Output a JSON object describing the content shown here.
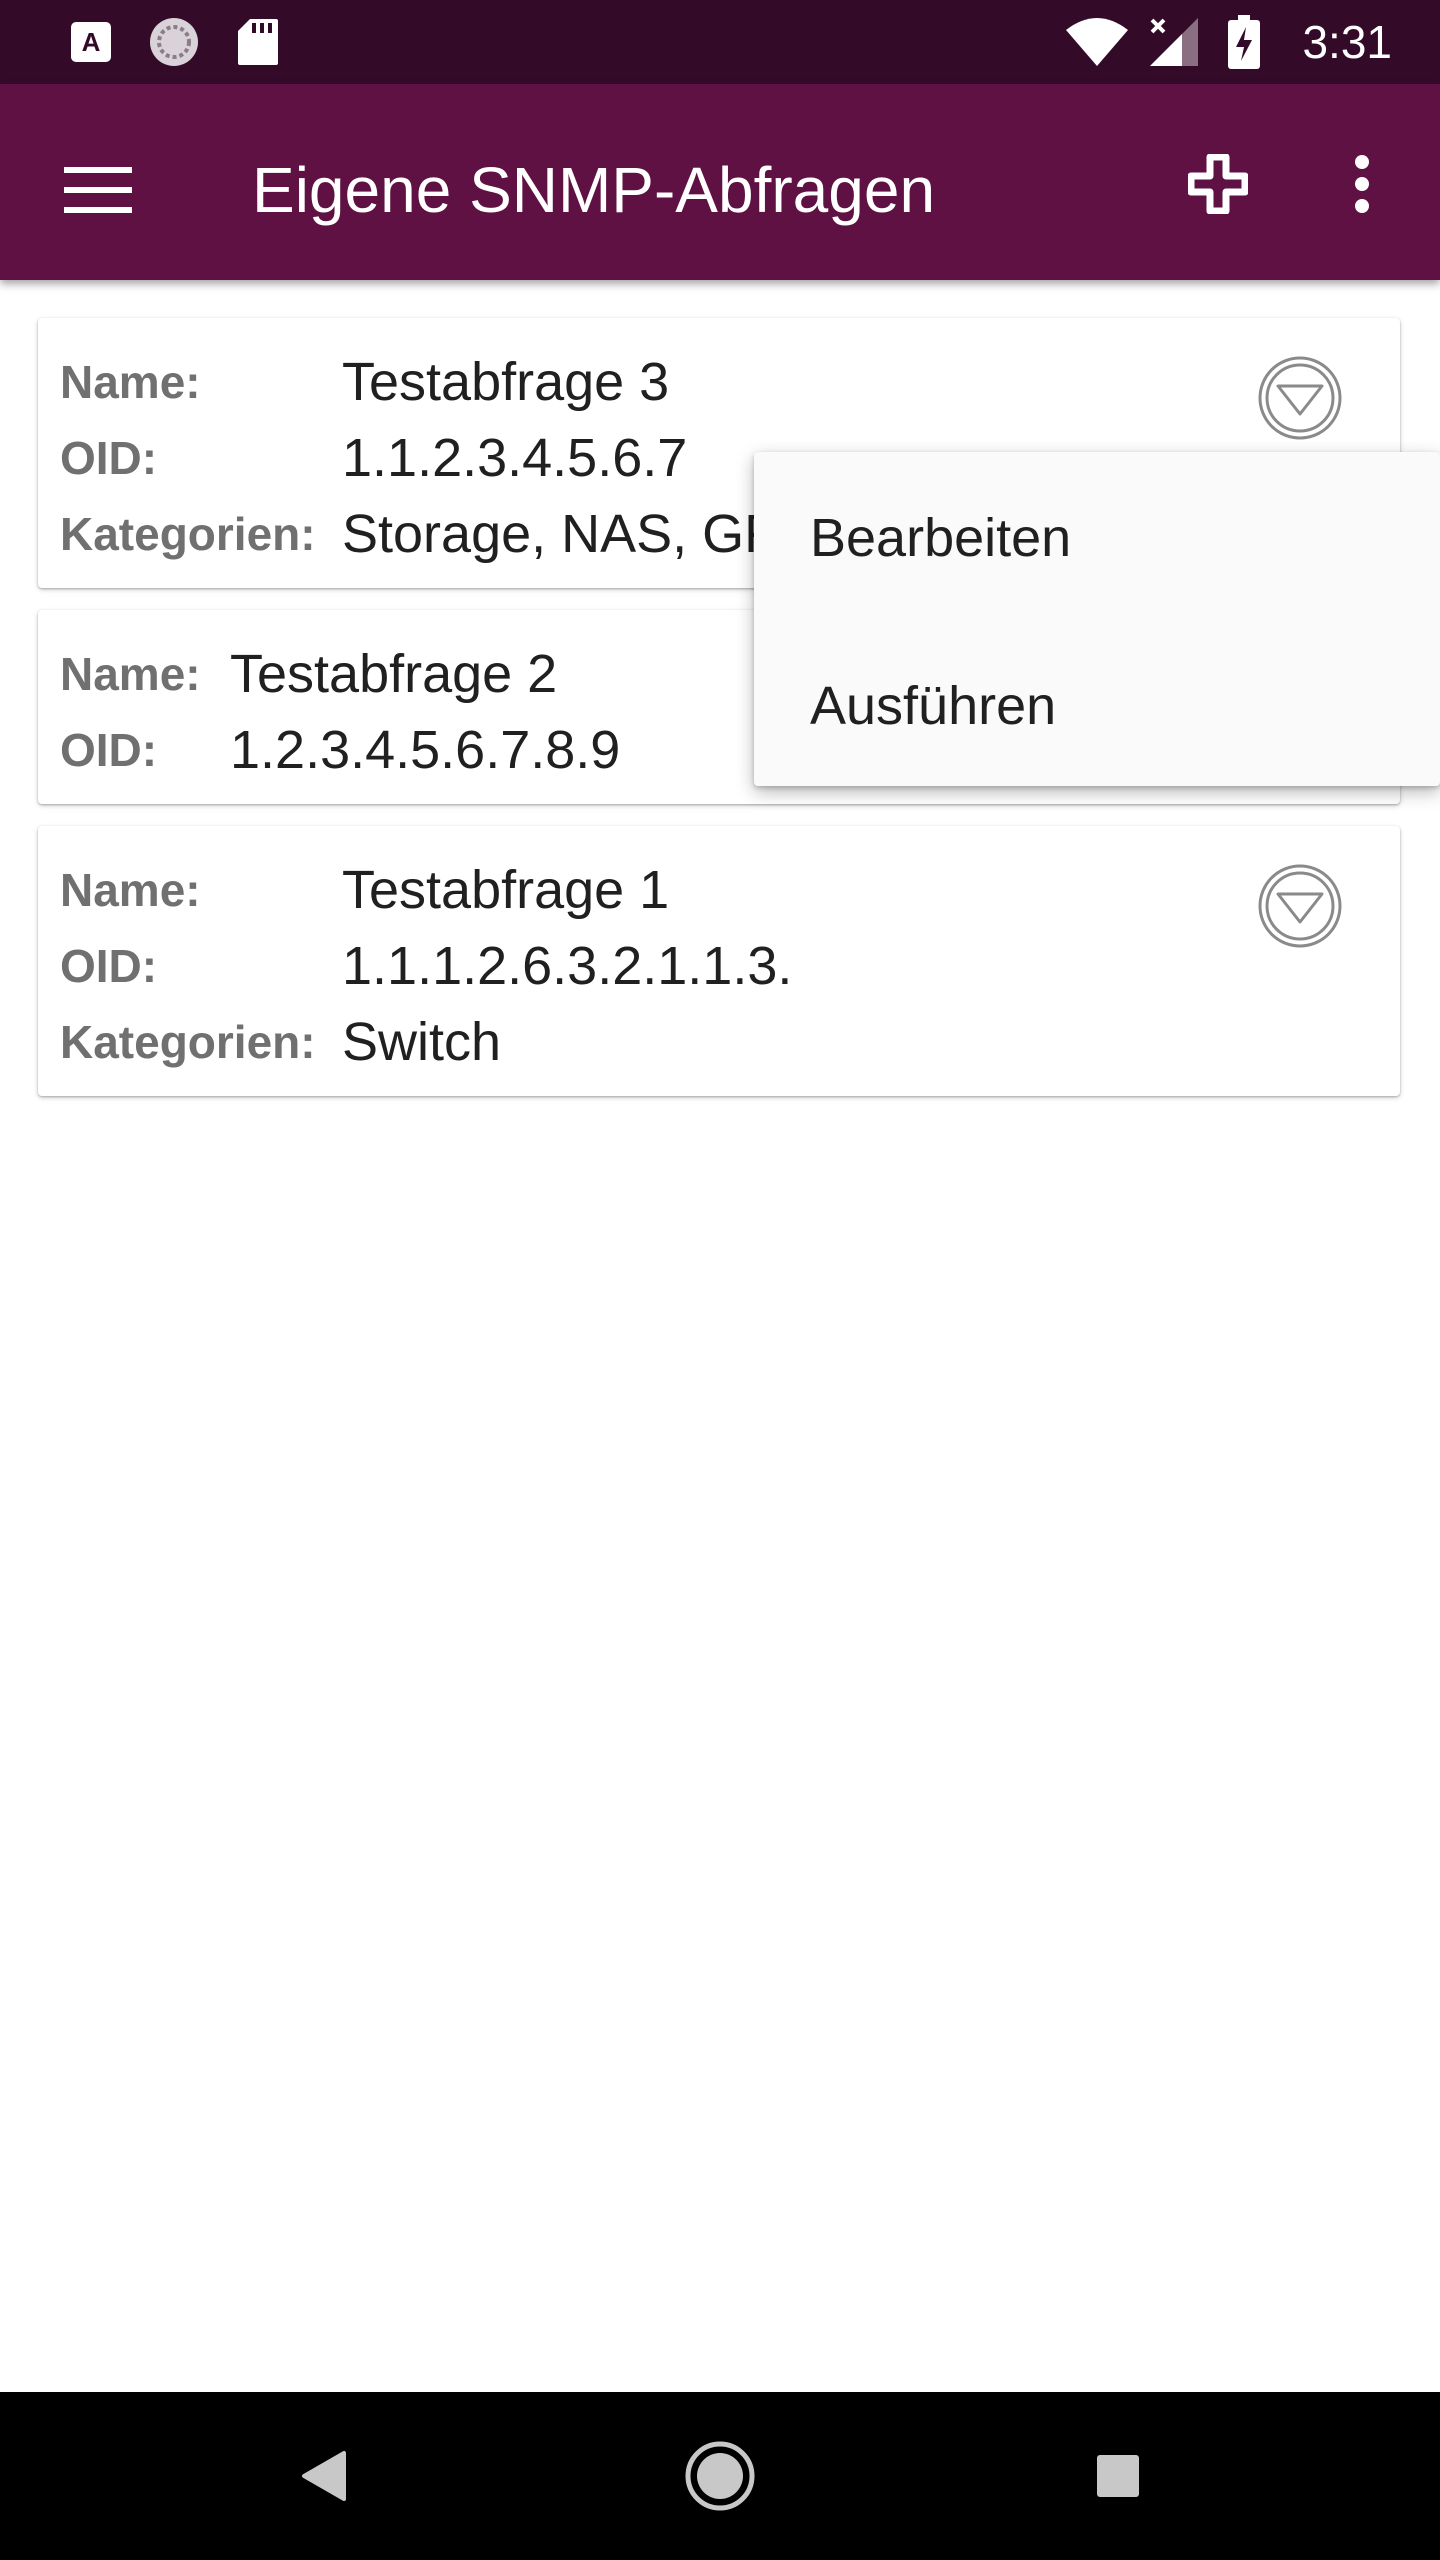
{
  "status_bar": {
    "time": "3:31",
    "icons": [
      "autofill-icon",
      "sync-icon",
      "sd-card-icon",
      "wifi-icon",
      "signal-icon",
      "battery-charging-icon"
    ]
  },
  "app_bar": {
    "title": "Eigene SNMP-Abfragen",
    "icons": [
      "menu-icon",
      "add-icon",
      "more-vert-icon"
    ],
    "color": "#5e1142"
  },
  "queries": [
    {
      "name_label": "Name:",
      "name": "Testabfrage 3",
      "oid_label": "OID:",
      "oid": "1.1.2.3.4.5.6.7",
      "categories_label": "Kategorien:",
      "categories": "Storage, NAS, GF"
    },
    {
      "name_label": "Name:",
      "name": "Testabfrage 2",
      "oid_label": "OID:",
      "oid": "1.2.3.4.5.6.7.8.9"
    },
    {
      "name_label": "Name:",
      "name": "Testabfrage 1",
      "oid_label": "OID:",
      "oid": "1.1.1.2.6.3.2.1.1.3.",
      "categories_label": "Kategorien:",
      "categories": "Switch"
    }
  ],
  "context_menu": {
    "items": [
      "Bearbeiten",
      "Ausführen"
    ]
  },
  "nav_bar": {
    "icons": [
      "back-icon",
      "home-icon",
      "recents-icon"
    ]
  },
  "status_bar_color": "#330b29"
}
